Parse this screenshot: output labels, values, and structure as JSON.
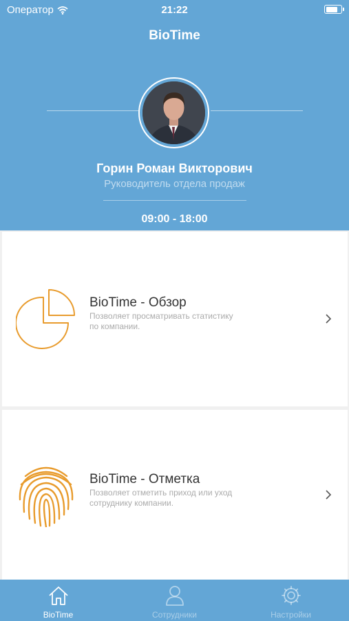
{
  "status_bar": {
    "carrier": "Оператор",
    "time": "21:22",
    "battery_level": 0.9
  },
  "header": {
    "title": "BioTime"
  },
  "profile": {
    "name": "Горин Роман Викторович",
    "role": "Руководитель отдела продаж",
    "work_hours": "09:00 - 18:00"
  },
  "cards": [
    {
      "title": "BioTime - Обзор",
      "description": "Позволяет просматривать статистику по компании.",
      "icon": "pie-chart-icon"
    },
    {
      "title": "BioTime - Отметка",
      "description": "Позволяет отметить приход или уход сотруднику компании.",
      "icon": "fingerprint-icon"
    }
  ],
  "tabs": [
    {
      "label": "BioTime",
      "icon": "home-icon",
      "active": true
    },
    {
      "label": "Сотрудники",
      "icon": "person-icon",
      "active": false
    },
    {
      "label": "Настройки",
      "icon": "gear-icon",
      "active": false
    }
  ],
  "colors": {
    "header_bg": "#63a6d6",
    "accent_orange": "#e89b2c",
    "card_bg": "#ffffff"
  }
}
